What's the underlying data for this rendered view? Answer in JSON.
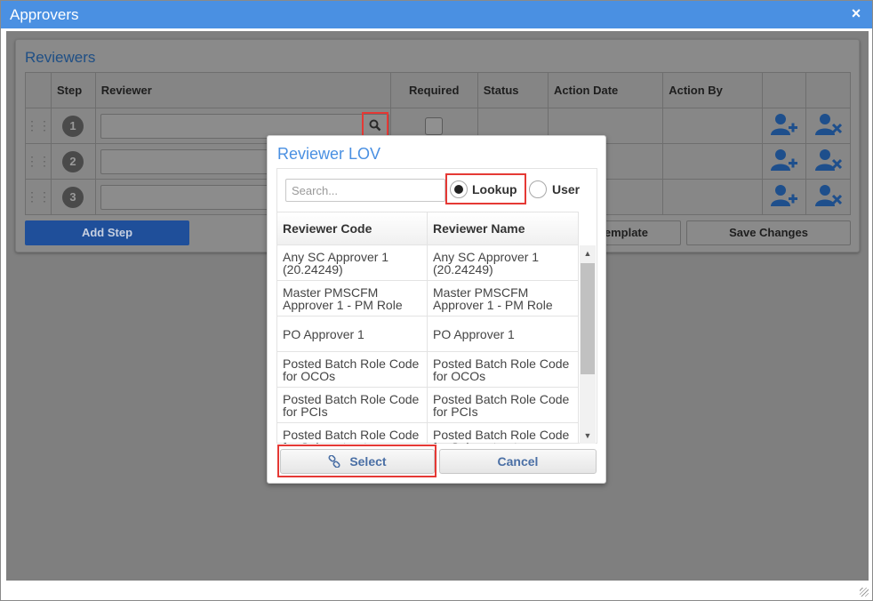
{
  "window": {
    "title": "Approvers",
    "close_label": "×"
  },
  "panel": {
    "title": "Reviewers",
    "columns": [
      "Step",
      "Reviewer",
      "Required",
      "Status",
      "Action Date",
      "Action By"
    ],
    "rows": [
      {
        "step": "1"
      },
      {
        "step": "2"
      },
      {
        "step": "3"
      }
    ],
    "buttons": {
      "add_step": "Add Step",
      "template": "emplate",
      "save": "Save Changes"
    }
  },
  "lov": {
    "title": "Reviewer LOV",
    "search_placeholder": "Search...",
    "radio_lookup": "Lookup",
    "radio_user": "User",
    "selected_radio": "Lookup",
    "columns": {
      "code": "Reviewer Code",
      "name": "Reviewer Name"
    },
    "rows": [
      {
        "code": "Any SC Approver 1 (20.24249)",
        "name": "Any SC Approver 1 (20.24249)"
      },
      {
        "code": "Master PMSCFM Approver 1 - PM Role",
        "name": "Master PMSCFM Approver 1 - PM Role"
      },
      {
        "code": "PO Approver 1",
        "name": "PO Approver 1"
      },
      {
        "code": "Posted Batch Role Code for OCOs",
        "name": "Posted Batch Role Code for OCOs"
      },
      {
        "code": "Posted Batch Role Code for PCIs",
        "name": "Posted Batch Role Code for PCIs"
      },
      {
        "code": "Posted Batch Role Code for Subcontracts",
        "name": "Posted Batch Role Code for Subcontracts"
      }
    ],
    "buttons": {
      "select": "Select",
      "cancel": "Cancel"
    }
  },
  "colors": {
    "accent": "#4a90e2",
    "highlight": "#e53935",
    "icon_blue": "#2f6fb5"
  }
}
